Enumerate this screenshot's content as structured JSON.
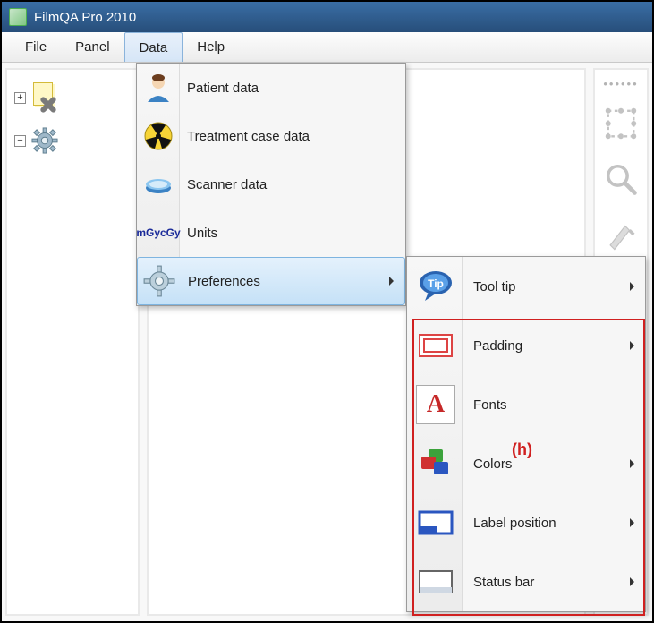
{
  "app": {
    "title": "FilmQA Pro 2010"
  },
  "menubar": {
    "file": "File",
    "panel": "Panel",
    "data": "Data",
    "help": "Help"
  },
  "sidebar": {
    "item0_expand": "+",
    "item1_expand": "−"
  },
  "data_menu": {
    "patient": "Patient data",
    "treatment": "Treatment case data",
    "scanner": "Scanner data",
    "units": "Units",
    "units_icon_top": "mGy",
    "units_icon_bot": "cGy",
    "preferences": "Preferences"
  },
  "pref_menu": {
    "tooltip": "Tool tip",
    "padding": "Padding",
    "fonts": "Fonts",
    "colors": "Colors",
    "labelpos": "Label position",
    "statusbar": "Status bar",
    "tip_icon_text": "Tip",
    "font_icon_text": "A"
  },
  "annotation": {
    "h": "(h)"
  }
}
